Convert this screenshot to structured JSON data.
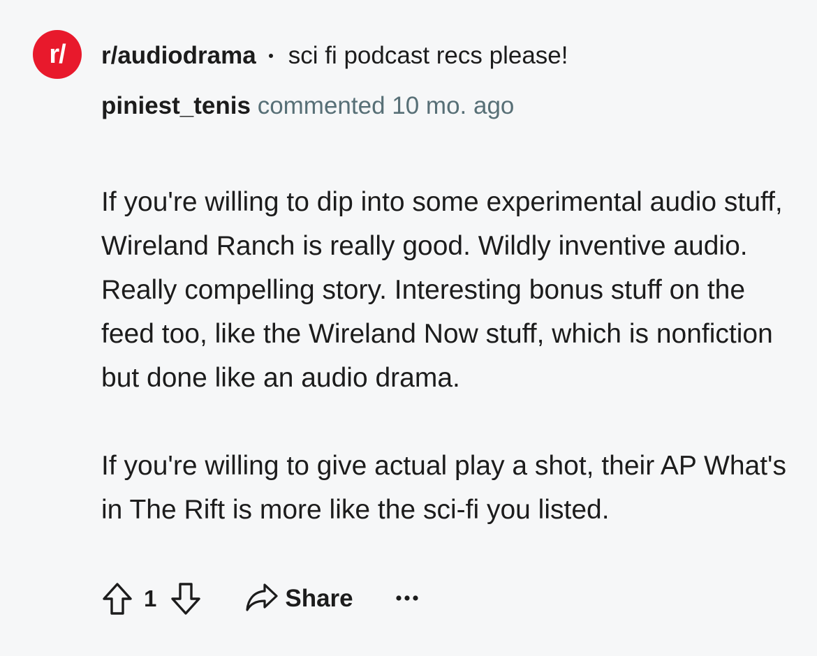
{
  "accent": "#e8192c",
  "subreddit": {
    "avatar_text": "r/",
    "name": "r/audiodrama",
    "post_title": "sci fi podcast recs please!"
  },
  "comment": {
    "author": "piniest_tenis",
    "meta_text": "commented 10 mo. ago",
    "paragraphs": [
      "If you're willing to dip into some experimental audio stuff, Wireland Ranch is really good. Wildly inventive audio. Really compelling story. Interesting bonus stuff on the feed too, like the Wireland Now stuff, which is nonfiction but done like an audio drama.",
      "If you're willing to give actual play a shot, their AP What's in The Rift is more like the sci-fi you listed."
    ]
  },
  "actions": {
    "vote_count": "1",
    "share_label": "Share",
    "icons": [
      "upvote-icon",
      "downvote-icon",
      "share-icon",
      "more-options-icon"
    ]
  }
}
